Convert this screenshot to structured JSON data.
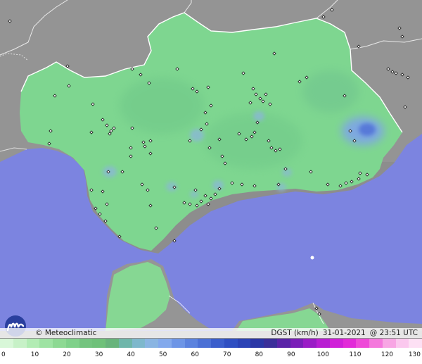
{
  "map": {
    "credit": "© Meteoclimatic",
    "variable": "DGST (km/h)",
    "date": "31-01-2021",
    "time": "@ 23:51 UTC",
    "logo_icon": "meteoclimatic-logo-icon",
    "station_icon": "station-marker-icon",
    "colors": {
      "sea": "#7c84e0",
      "land_outside": "#8d8d8d",
      "andalucia": "#7ed690",
      "border": "#ffffff"
    }
  },
  "legend": {
    "labels": [
      "0",
      "10",
      "20",
      "30",
      "40",
      "50",
      "60",
      "70",
      "80",
      "90",
      "100",
      "110",
      "120",
      "130"
    ],
    "colors": [
      "#d8f7d8",
      "#c7f1c7",
      "#b2ecb4",
      "#9ee3a3",
      "#8dd993",
      "#7fd18a",
      "#74c47f",
      "#6fc17a",
      "#68b47c",
      "#6fb6aa",
      "#7eb8cc",
      "#8ab5e2",
      "#83a9ec",
      "#6d95e6",
      "#5b82de",
      "#4b70d5",
      "#3b5ecc",
      "#2f4fc2",
      "#2b43b6",
      "#2b37a6",
      "#3b2f9a",
      "#5a24a8",
      "#7a1fb8",
      "#9a1cc6",
      "#b81ed2",
      "#d020d8",
      "#e22ad8",
      "#ee4ad8",
      "#f478dc",
      "#f8a6e4",
      "#fbc8ee",
      "#fde0f4"
    ]
  }
}
